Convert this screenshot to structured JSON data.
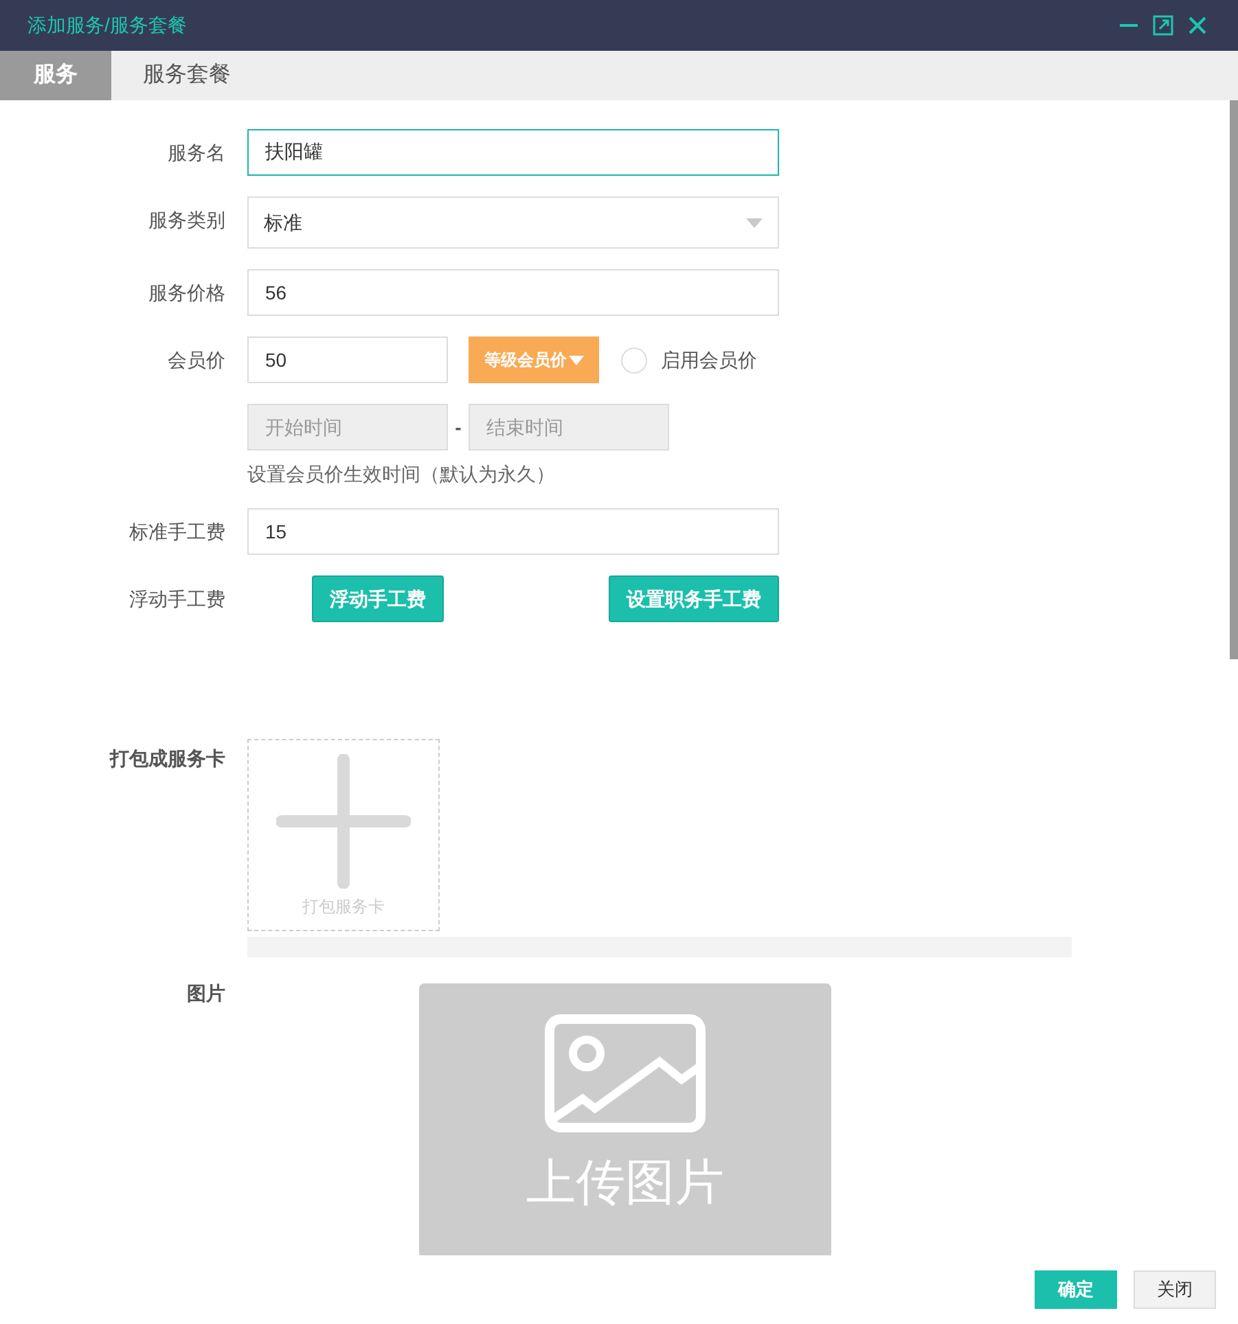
{
  "window": {
    "title": "添加服务/服务套餐"
  },
  "tabs": [
    {
      "label": "服务",
      "selected": true
    },
    {
      "label": "服务套餐",
      "selected": false
    }
  ],
  "form": {
    "service_name": {
      "label": "服务名",
      "value": "扶阳罐",
      "focused": true
    },
    "service_category": {
      "label": "服务类别",
      "value": "标准"
    },
    "service_price": {
      "label": "服务价格",
      "value": "56"
    },
    "member_price": {
      "label": "会员价",
      "value": "50",
      "level_button": "等级会员价",
      "enable_label": "启用会员价",
      "enabled": false
    },
    "validity": {
      "start_placeholder": "开始时间",
      "separator": "-",
      "end_placeholder": "结束时间",
      "hint": "设置会员价生效时间（默认为永久）"
    },
    "standard_labor_fee": {
      "label": "标准手工费",
      "value": "15"
    },
    "floating_labor_fee": {
      "label": "浮动手工费",
      "buttons": [
        "浮动手工费",
        "设置职务手工费"
      ]
    },
    "service_card": {
      "label": "打包成服务卡",
      "add_label": "打包服务卡"
    },
    "image": {
      "label": "图片",
      "upload_label": "上传图片"
    }
  },
  "footer": {
    "buttons": [
      {
        "label": "确定",
        "primary": true
      },
      {
        "label": "关闭",
        "primary": false
      }
    ]
  }
}
